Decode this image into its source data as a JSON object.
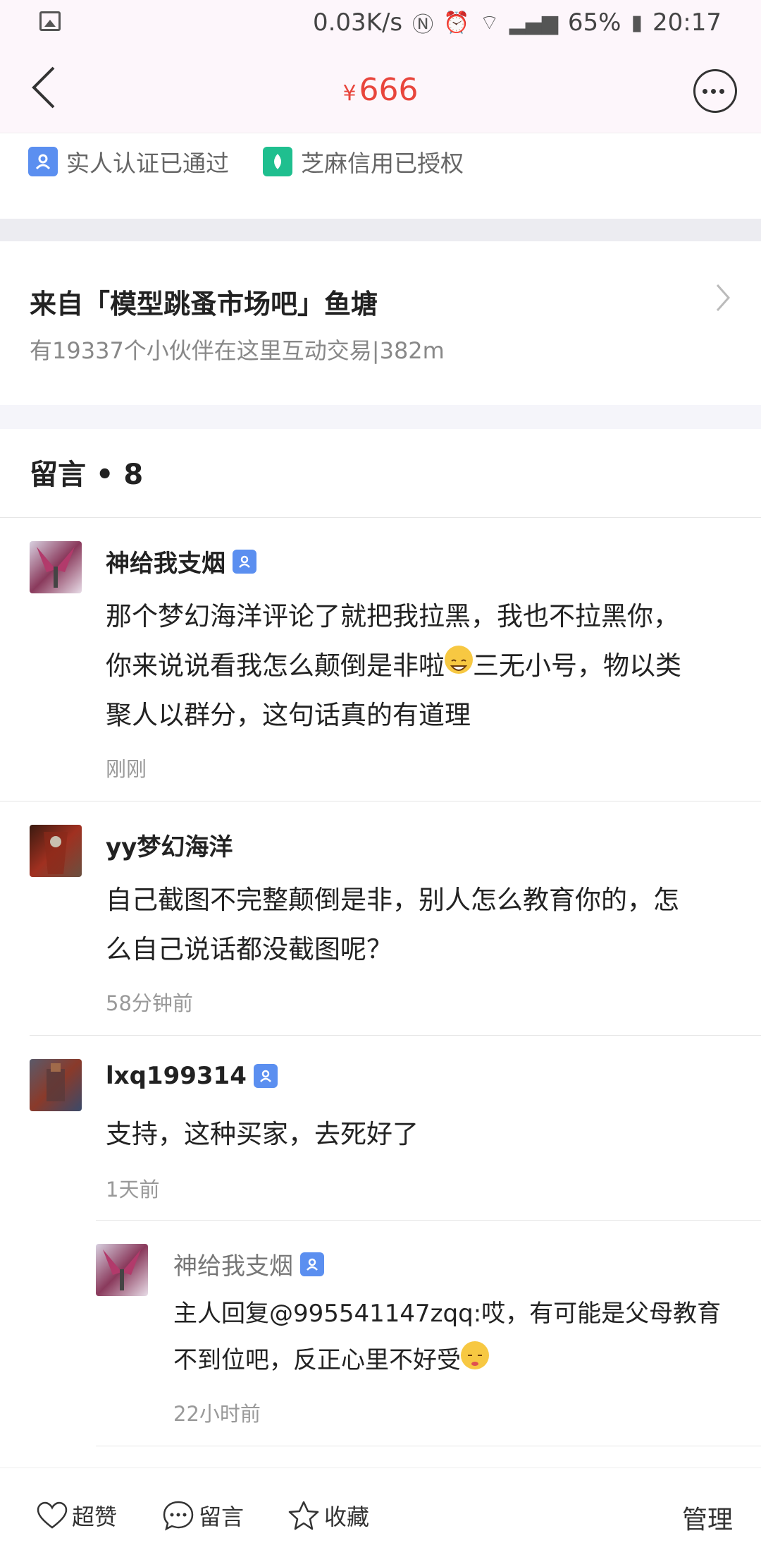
{
  "status_bar": {
    "speed": "0.03K/s",
    "battery": "65%",
    "time": "20:17",
    "icons": [
      "image-icon",
      "nfc-icon",
      "alarm-icon",
      "wifi-icon",
      "4g-signal-icon",
      "battery-icon"
    ]
  },
  "header": {
    "currency": "¥",
    "price": "666"
  },
  "certs": {
    "real_name": "实人认证已通过",
    "sesame": "芝麻信用已授权"
  },
  "pond": {
    "title": "来自「模型跳蚤市场吧」鱼塘",
    "subtitle": "有19337个小伙伴在这里互动交易|382m"
  },
  "comments": {
    "header": "留言 • 8",
    "items": [
      {
        "name": "神给我支烟",
        "text1": "那个梦幻海洋评论了就把我拉黑，我也不拉黑你，",
        "text2a": "你来说说看我怎么颠倒是非啦",
        "text2b": "三无小号，物以类",
        "text3": "聚人以群分，这句话真的有道理",
        "time": "刚刚"
      },
      {
        "name": "yy梦幻海洋",
        "text1": "自己截图不完整颠倒是非，别人怎么教育你的，怎",
        "text2": "么自己说话都没截图呢？",
        "time": "58分钟前"
      },
      {
        "name": "lxq199314",
        "text1": "支持，这种买家，去死好了",
        "time": "1天前"
      },
      {
        "name": "神给我支烟",
        "text1": "主人回复@995541147zqq:哎，有可能是父母教育",
        "text2": "不到位吧，反正心里不好受",
        "time": "22小时前"
      }
    ]
  },
  "bottom_bar": {
    "like": "超赞",
    "comment": "留言",
    "favorite": "收藏",
    "manage": "管理"
  },
  "colors": {
    "price": "#e8453c",
    "badge": "#5b8ff0",
    "sesame": "#1fbf8f"
  }
}
